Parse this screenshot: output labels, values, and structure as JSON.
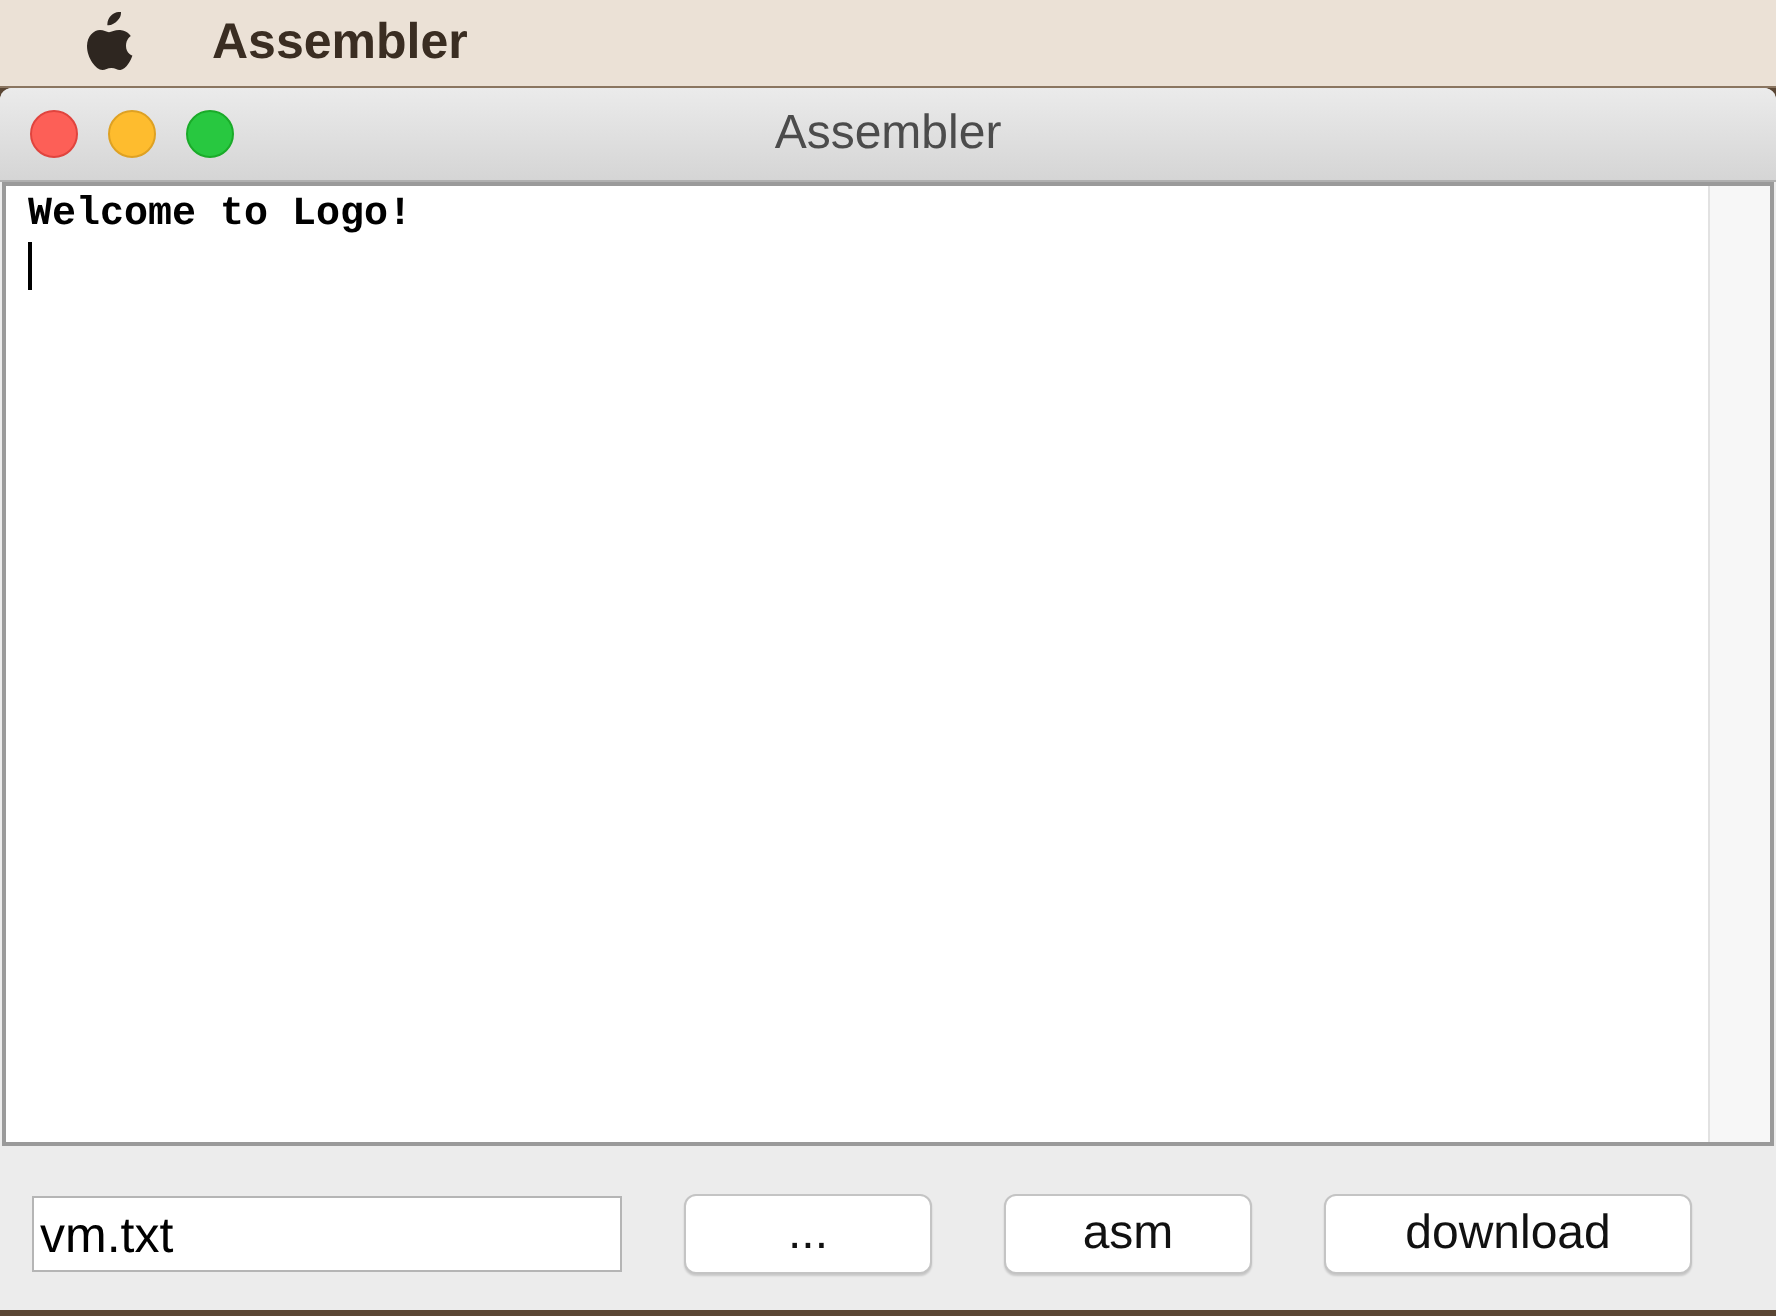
{
  "menu_bar": {
    "app_name": "Assembler"
  },
  "window": {
    "title": "Assembler"
  },
  "console": {
    "lines": [
      "Welcome to Logo!"
    ]
  },
  "file_field": {
    "value": "vm.txt"
  },
  "buttons": [
    "...",
    "asm",
    "download"
  ]
}
